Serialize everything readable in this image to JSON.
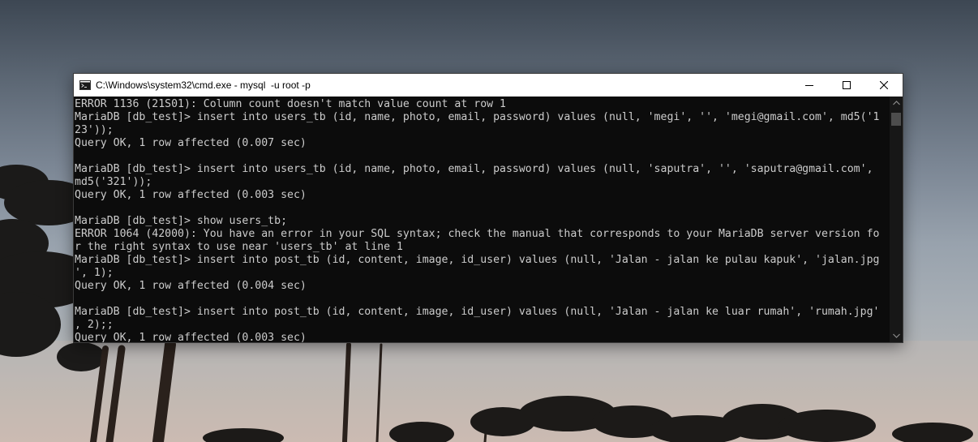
{
  "window": {
    "title": "C:\\Windows\\system32\\cmd.exe - mysql  -u root -p",
    "icon": "cmd-icon",
    "controls": [
      "minimize-icon",
      "maximize-icon",
      "close-icon"
    ]
  },
  "console": {
    "lines": [
      "ERROR 1136 (21S01): Column count doesn't match value count at row 1",
      "MariaDB [db_test]> insert into users_tb (id, name, photo, email, password) values (null, 'megi', '', 'megi@gmail.com', md5('1",
      "23'));",
      "Query OK, 1 row affected (0.007 sec)",
      "",
      "MariaDB [db_test]> insert into users_tb (id, name, photo, email, password) values (null, 'saputra', '', 'saputra@gmail.com',",
      "md5('321'));",
      "Query OK, 1 row affected (0.003 sec)",
      "",
      "MariaDB [db_test]> show users_tb;",
      "ERROR 1064 (42000): You have an error in your SQL syntax; check the manual that corresponds to your MariaDB server version fo",
      "r the right syntax to use near 'users_tb' at line 1",
      "MariaDB [db_test]> insert into post_tb (id, content, image, id_user) values (null, 'Jalan - jalan ke pulau kapuk', 'jalan.jpg",
      "', 1);",
      "Query OK, 1 row affected (0.004 sec)",
      "",
      "MariaDB [db_test]> insert into post_tb (id, content, image, id_user) values (null, 'Jalan - jalan ke luar rumah', 'rumah.jpg'",
      ", 2);;",
      "Query OK, 1 row affected (0.003 sec)"
    ]
  },
  "colors": {
    "console_bg": "#0c0c0c",
    "console_text": "#cccccc",
    "titlebar_bg": "#ffffff"
  }
}
